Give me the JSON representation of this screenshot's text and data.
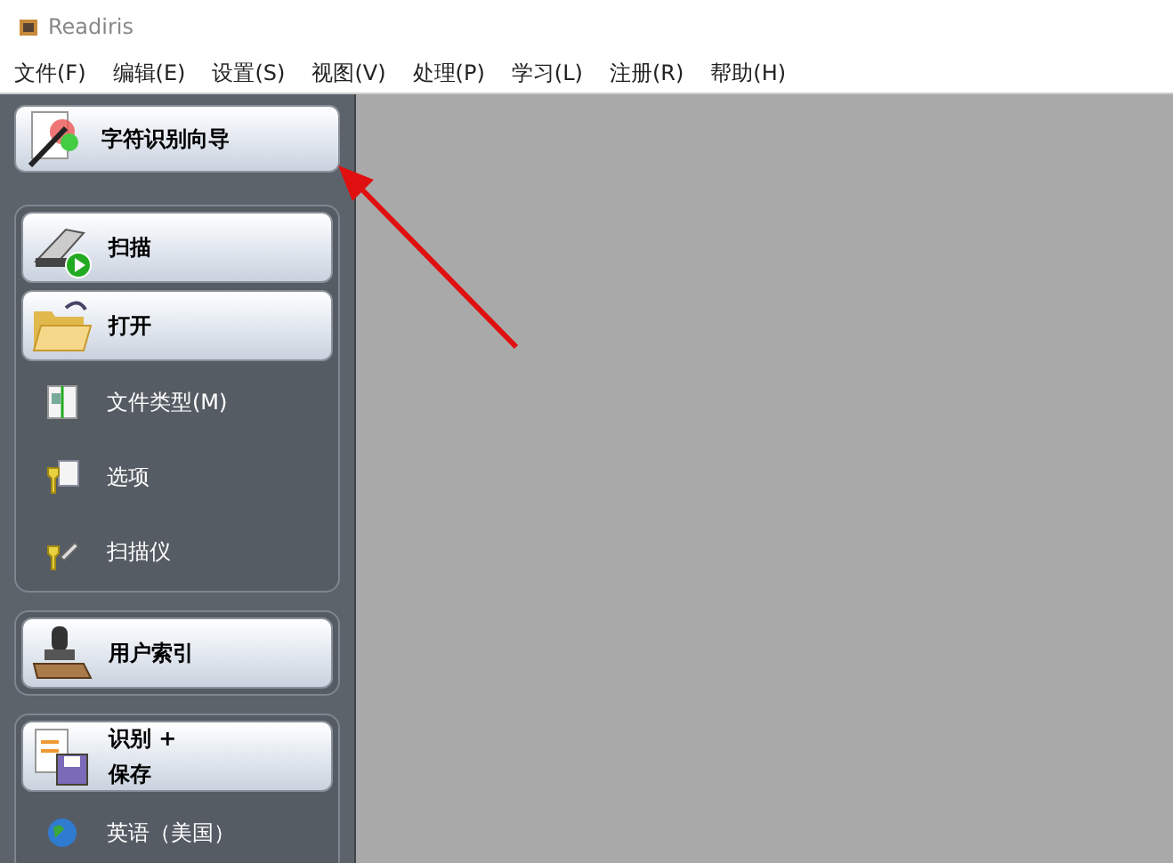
{
  "window": {
    "title": "Readiris"
  },
  "menu": [
    "文件(F)",
    "编辑(E)",
    "设置(S)",
    "视图(V)",
    "处理(P)",
    "学习(L)",
    "注册(R)",
    "帮助(H)"
  ],
  "sidebar": {
    "wizard": {
      "label": "字符识别向导"
    },
    "groups": [
      {
        "items": [
          {
            "kind": "button",
            "label": "扫描"
          },
          {
            "kind": "button",
            "label": "打开"
          },
          {
            "kind": "item",
            "label": "文件类型(M)"
          },
          {
            "kind": "item",
            "label": "选项"
          },
          {
            "kind": "item",
            "label": "扫描仪"
          }
        ]
      },
      {
        "items": [
          {
            "kind": "button",
            "label": "用户索引"
          }
        ]
      },
      {
        "items": [
          {
            "kind": "button",
            "label": "识别 +\n保存"
          },
          {
            "kind": "item",
            "label": "英语（美国）"
          }
        ]
      }
    ]
  }
}
